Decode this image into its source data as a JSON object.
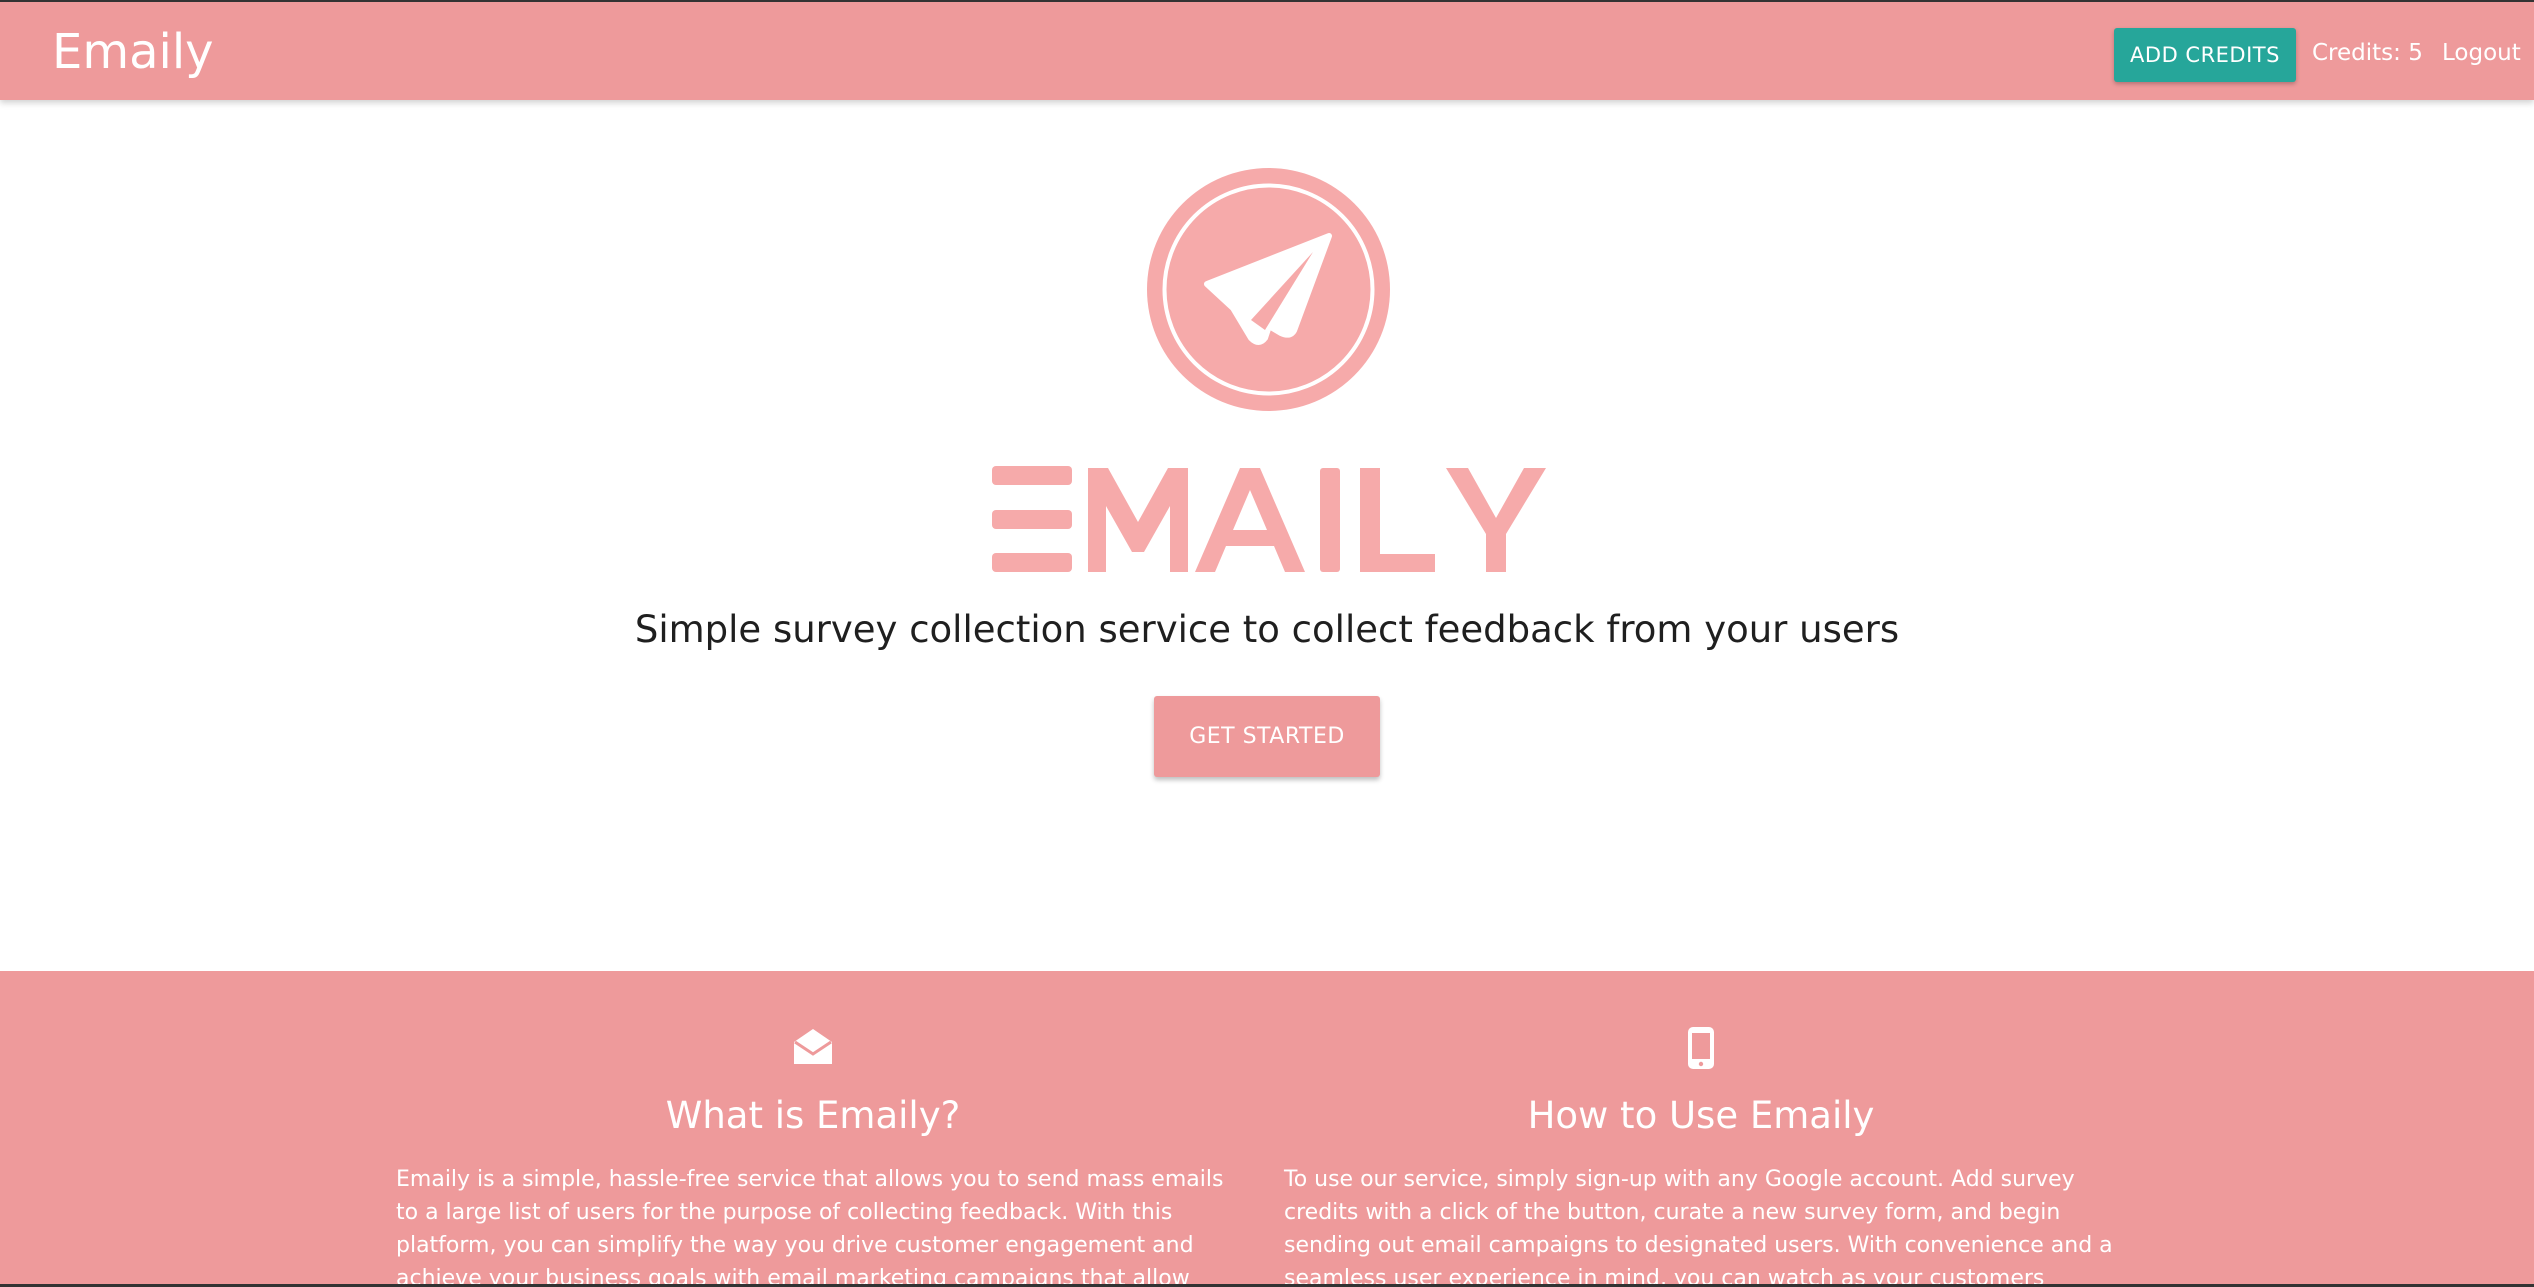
{
  "navbar": {
    "brand": "Emaily",
    "add_credits_label": "ADD CREDITS",
    "credits_label": "Credits: 5",
    "logout_label": "Logout"
  },
  "hero": {
    "logo_icon": "paper-plane-icon",
    "wordmark": "EMAILY",
    "tagline": "Simple survey collection service to collect feedback from your users",
    "cta_label": "GET STARTED"
  },
  "info": {
    "columns": [
      {
        "icon": "envelope-open-icon",
        "title": "What is Emaily?",
        "text": "Emaily is a simple, hassle-free service that allows you to send mass emails to a large list of users for the purpose of collecting feedback. With this platform, you can simplify the way you drive customer engagement and achieve your business goals with email marketing campaigns that allow you to track service results."
      },
      {
        "icon": "mobile-phone-icon",
        "title": "How to Use Emaily",
        "text": "To use our service, simply sign-up with any Google account. Add survey credits with a click of the button, curate a new survey form, and begin sending out email campaigns to designated users. With convenience and a seamless user experience in mind, you can watch as your customers respond to your inquiry while we take care of the rest."
      }
    ]
  },
  "colors": {
    "brand_pink": "#ee9a9b",
    "logo_pink": "#f6aaaa",
    "accent_teal": "#26a69a",
    "text_dark": "#1f1f1f"
  }
}
